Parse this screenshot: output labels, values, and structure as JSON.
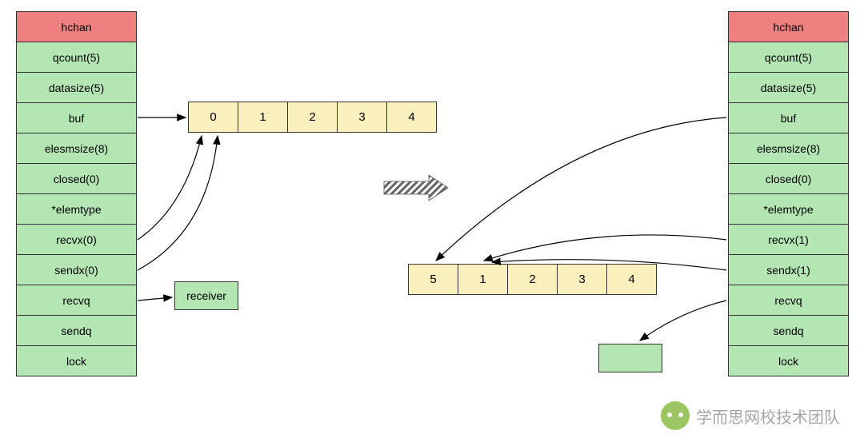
{
  "left_struct": {
    "header": "hchan",
    "fields": [
      "qcount(5)",
      "datasize(5)",
      "buf",
      "elesmsize(8)",
      "closed(0)",
      "*elemtype",
      "recvx(0)",
      "sendx(0)",
      "recvq",
      "sendq",
      "lock"
    ]
  },
  "right_struct": {
    "header": "hchan",
    "fields": [
      "qcount(5)",
      "datasize(5)",
      "buf",
      "elesmsize(8)",
      "closed(0)",
      "*elemtype",
      "recvx(1)",
      "sendx(1)",
      "recvq",
      "sendq",
      "lock"
    ]
  },
  "left_buffer": [
    "0",
    "1",
    "2",
    "3",
    "4"
  ],
  "right_buffer": [
    "5",
    "1",
    "2",
    "3",
    "4"
  ],
  "receiver_label": "receiver",
  "watermark": "学而思网校技术团队"
}
